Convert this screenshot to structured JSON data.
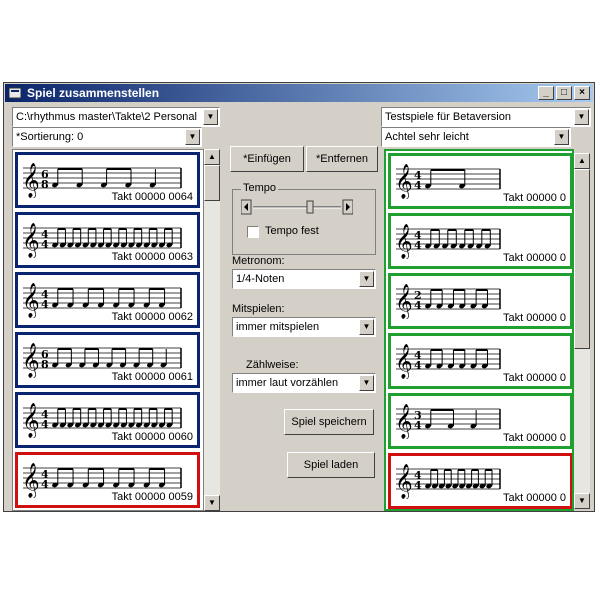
{
  "window": {
    "title": "Spiel zusammenstellen"
  },
  "left": {
    "path": "C:\\rhythmus master\\Takte\\2 Personal",
    "sort": "*Sortierung: 0",
    "cards": [
      {
        "label": "Takt 00000 0064",
        "time": [
          "6",
          "8"
        ]
      },
      {
        "label": "Takt 00000 0063",
        "time": [
          "4",
          "4"
        ]
      },
      {
        "label": "Takt 00000 0062",
        "time": [
          "4",
          "4"
        ]
      },
      {
        "label": "Takt 00000 0061",
        "time": [
          "6",
          "8"
        ]
      },
      {
        "label": "Takt 00000 0060",
        "time": [
          "4",
          "4"
        ]
      },
      {
        "label": "Takt 00000 0059",
        "time": [
          "4",
          "4"
        ]
      }
    ]
  },
  "middle": {
    "insert_button": "*Einfügen",
    "remove_button": "*Entfernen",
    "tempo_label": "Tempo",
    "tempo_fixed_label": "Tempo fest",
    "metronom_label": "Metronom:",
    "metronom_value": "1/4-Noten",
    "mitspielen_label": "Mitspielen:",
    "mitspielen_value": "immer mitspielen",
    "zaehlweise_label": "Zählweise:",
    "zaehlweise_value": "immer laut vorzählen",
    "save_button": "Spiel speichern",
    "load_button": "Spiel laden"
  },
  "right": {
    "collection": "Testspiele für Betaversion",
    "level": "Achtel sehr leicht",
    "cards": [
      {
        "label": "Takt 00000 0",
        "time": [
          "4",
          "4"
        ]
      },
      {
        "label": "Takt 00000 0",
        "time": [
          "4",
          "4"
        ]
      },
      {
        "label": "Takt 00000 0",
        "time": [
          "2",
          "4"
        ]
      },
      {
        "label": "Takt 00000 0",
        "time": [
          "4",
          "4"
        ]
      },
      {
        "label": "Takt 00000 0",
        "time": [
          "3",
          "4"
        ]
      },
      {
        "label": "Takt 00000 0",
        "time": [
          "4",
          "4"
        ]
      }
    ]
  },
  "icons": {
    "app": "app-icon",
    "minimize": "minimize-icon",
    "maximize": "maximize-icon",
    "close": "close-icon",
    "dropdown": "chevron-down-icon",
    "scroll_up": "scroll-up-icon",
    "scroll_down": "scroll-down-icon"
  },
  "colors": {
    "title_start": "#0a246a",
    "title_end": "#a6caf0",
    "selected": "#d01010",
    "left_border": "#0a2470",
    "right_border": "#20a030"
  }
}
